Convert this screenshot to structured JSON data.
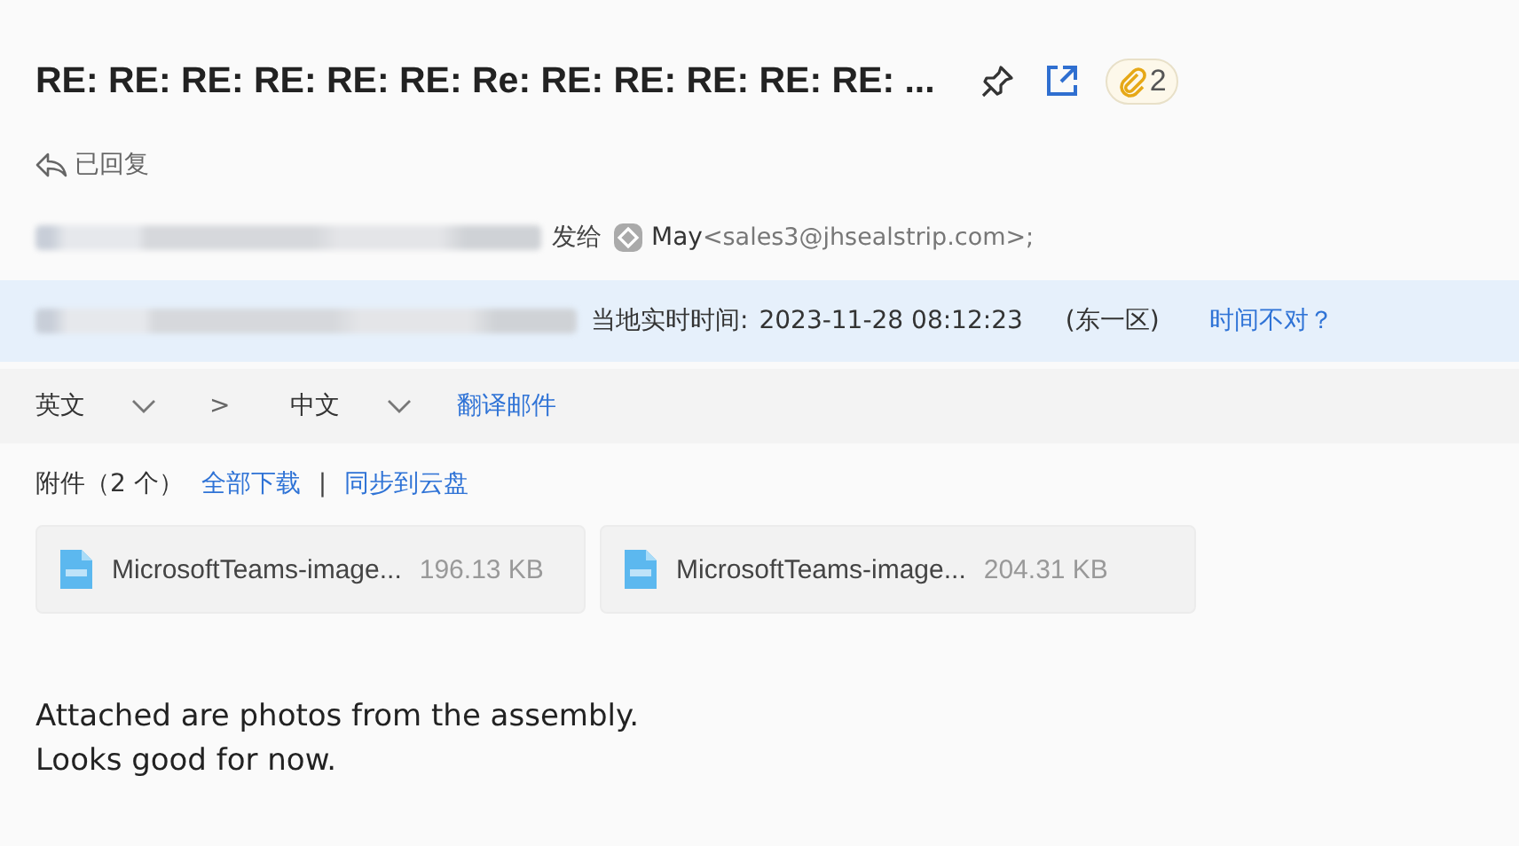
{
  "subject": "RE: RE: RE: RE: RE: RE: Re: RE: RE: RE: RE: RE: ...",
  "attachment_count": "2",
  "reply_status": "已回复",
  "sender": {
    "sent_to": "发给",
    "recipient_name": "May",
    "recipient_email": "<sales3@jhsealstrip.com>;"
  },
  "timezone_bar": {
    "label": "当地实时时间:",
    "datetime": "2023-11-28 08:12:23",
    "zone": "(东一区)",
    "link": "时间不对？"
  },
  "translate_bar": {
    "from": "英文",
    "arrow": ">",
    "to": "中文",
    "action": "翻译邮件"
  },
  "attachments": {
    "title": "附件（2 个）",
    "download_all": "全部下载",
    "separator": "|",
    "sync": "同步到云盘",
    "files": [
      {
        "name": "MicrosoftTeams-image...",
        "size": "196.13 KB"
      },
      {
        "name": "MicrosoftTeams-image...",
        "size": "204.31 KB"
      }
    ]
  },
  "body": [
    "Attached are photos from the assembly.",
    "Looks good for now."
  ]
}
